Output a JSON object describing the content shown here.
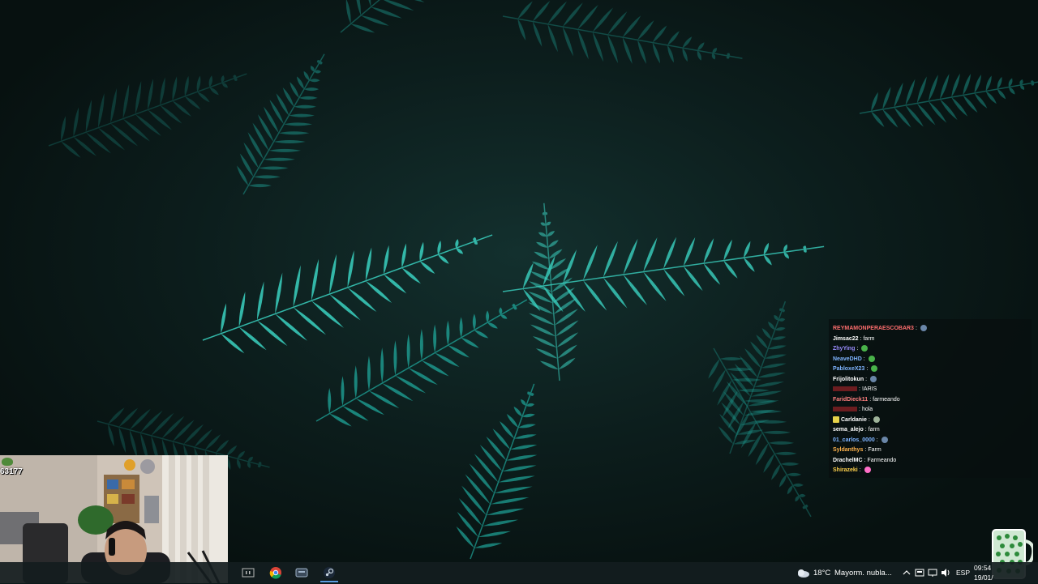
{
  "chat": {
    "messages": [
      {
        "user": "REYMAMONPERAESCOBAR3",
        "sep": ":",
        "text": "",
        "user_color": "#ff6e6e",
        "emote": "globe-emote",
        "emote_color": "#6a86a8"
      },
      {
        "user": "Jimsac22",
        "sep": ":",
        "text": "farm",
        "user_color": "#ffffff",
        "emote": "",
        "emote_color": ""
      },
      {
        "user": "ZhyYing",
        "sep": ":",
        "text": "",
        "user_color": "#9a8cff",
        "emote": "pepe-emote",
        "emote_color": "#49b34a"
      },
      {
        "user": "NeaveDHD",
        "sep": ":",
        "text": "",
        "user_color": "#7fb4ff",
        "emote": "pepe-emote",
        "emote_color": "#49b34a"
      },
      {
        "user": "PabloxeX23",
        "sep": ":",
        "text": "",
        "user_color": "#7fb4ff",
        "emote": "pepe-emote",
        "emote_color": "#49b34a"
      },
      {
        "user": "Frijolitokun",
        "sep": ":",
        "text": "",
        "user_color": "#ffffff",
        "emote": "globe-emote",
        "emote_color": "#6a86a8"
      },
      {
        "user": "",
        "sep": ":",
        "text": "!ARIS",
        "user_color": "#c0282d",
        "emote": "",
        "emote_color": ""
      },
      {
        "user": "FaridDieck11",
        "sep": ":",
        "text": "farmeando",
        "user_color": "#ff7f7f",
        "emote": "",
        "emote_color": ""
      },
      {
        "user": "",
        "sep": ":",
        "text": "hola",
        "user_color": "#c0282d",
        "emote": "",
        "emote_color": ""
      },
      {
        "user": "Carldanie",
        "sep": ":",
        "text": "",
        "user_color": "#ffffff",
        "emote": "clock-emote",
        "emote_color": "#9fb49a",
        "badge": "#e6d24a"
      },
      {
        "user": "sema_alejo",
        "sep": ":",
        "text": "farm",
        "user_color": "#ffffff",
        "emote": "",
        "emote_color": ""
      },
      {
        "user": "01_carlos_0000",
        "sep": ":",
        "text": "",
        "user_color": "#7fb4ff",
        "emote": "globe-emote",
        "emote_color": "#6a86a8"
      },
      {
        "user": "Syldanthys",
        "sep": ":",
        "text": "Farm",
        "user_color": "#ffb34d",
        "emote": "",
        "emote_color": ""
      },
      {
        "user": "DrachelMC",
        "sep": ":",
        "text": "Farmeando",
        "user_color": "#ffffff",
        "emote": "",
        "emote_color": ""
      },
      {
        "user": "Shirazeki",
        "sep": ":",
        "text": "",
        "user_color": "#ffd24d",
        "emote": "feather-emote",
        "emote_color": "#ff6fc8"
      }
    ]
  },
  "overlay": {
    "sub_count": "63177"
  },
  "taskbar": {
    "weather_temp": "18°C",
    "weather_desc": "Mayorm. nubla...",
    "language": "ESP",
    "time": "09:54",
    "date": "19/01/",
    "icons": [
      "twitch-icon",
      "chrome-icon",
      "app-icon",
      "steam-icon"
    ]
  },
  "colors": {
    "fern": "#1fa69a",
    "fern_bright": "#3ad1c0",
    "background": "#0c1a1a",
    "taskbar": "#141c1e"
  }
}
